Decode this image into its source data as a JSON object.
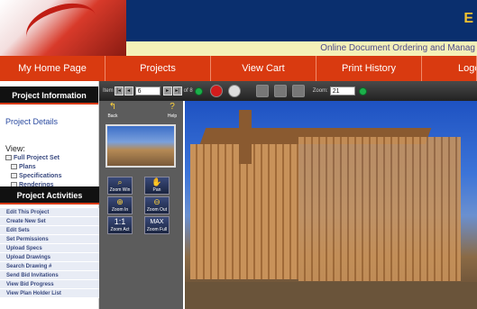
{
  "header": {
    "brand": "E",
    "tagline": "Online Document Ordering and Manag"
  },
  "nav": {
    "tabs": [
      {
        "label": "My Home Page"
      },
      {
        "label": "Projects"
      },
      {
        "label": "View Cart"
      },
      {
        "label": "Print History"
      },
      {
        "label": "Logo"
      }
    ]
  },
  "sidebar": {
    "project_info_title": "Project Information",
    "project_details": "Project Details",
    "view_label": "View:",
    "view_items": [
      "Full Project Set",
      "Plans",
      "Specifications",
      "Renderings"
    ],
    "activities_title": "Project Activities",
    "activities": [
      "Edit This Project",
      "Create New Set",
      "Edit Sets",
      "Set Permissions",
      "Upload Specs",
      "Upload Drawings",
      "Search Drawing #",
      "Send Bid Invitations",
      "View Bid Progress",
      "View Plan Holder List"
    ]
  },
  "toolbar": {
    "item_label": "Item",
    "item_value": "6",
    "of_label": "of 8",
    "info_label": "Info",
    "zoom_label": "Zoom:",
    "zoom_value": "21"
  },
  "tools": {
    "back_label": "Back",
    "help_label": "Help",
    "zoom_win": "Zoom Win",
    "pan": "Pan",
    "zoom_in": "Zoom In",
    "zoom_out": "Zoom Out",
    "actual_size_text": "1:1",
    "actual_size": "Zoom Act",
    "max_text": "MAX",
    "zoom_full": "Zoom Full"
  },
  "colors": {
    "nav_bg": "#d93a10",
    "header_bg": "#0a2f6e",
    "brand": "#f2c230"
  }
}
